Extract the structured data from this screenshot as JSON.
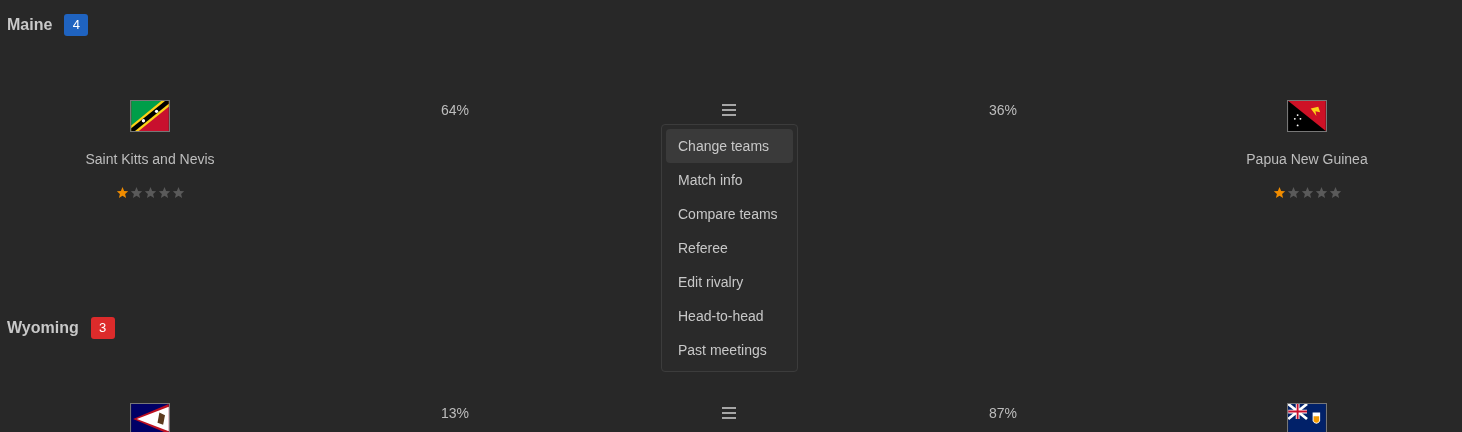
{
  "groups": [
    {
      "title": "Maine",
      "count": "4",
      "color": "#1f63c0",
      "match": {
        "home": {
          "kind": "kn",
          "name": "Saint Kitts and Nevis",
          "stars": 1
        },
        "home_share": "64%",
        "away_share": "36%",
        "away": {
          "kind": "pg",
          "name": "Papua New Guinea",
          "stars": 1
        },
        "menu": {
          "expanded": true,
          "items": [
            {
              "label": "Change teams",
              "selected": true
            },
            {
              "label": "Match info",
              "selected": false
            },
            {
              "label": "Compare teams",
              "selected": false
            },
            {
              "label": "Referee",
              "selected": false
            },
            {
              "label": "Edit rivalry",
              "selected": false
            },
            {
              "label": "Head-to-head",
              "selected": false
            },
            {
              "label": "Past meetings",
              "selected": false
            }
          ]
        }
      }
    },
    {
      "title": "Wyoming",
      "count": "3",
      "color": "#dc2b2b",
      "match": {
        "home": {
          "kind": "as"
        },
        "home_share": "13%",
        "away_share": "87%",
        "away": {
          "kind": "ai"
        },
        "menu": {
          "expanded": false
        }
      }
    }
  ]
}
